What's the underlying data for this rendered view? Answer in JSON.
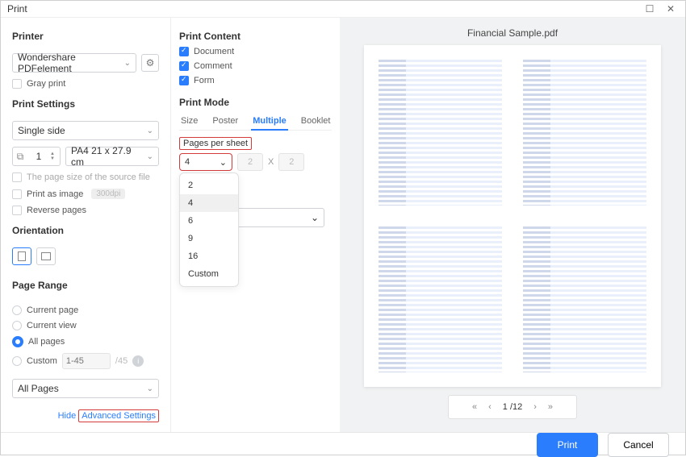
{
  "window": {
    "title": "Print"
  },
  "left": {
    "printer_title": "Printer",
    "printer_selected": "Wondershare PDFelement",
    "gray_print": "Gray print",
    "print_settings_title": "Print Settings",
    "sides_selected": "Single side",
    "copies": "1",
    "page_size_selected": "PA4 21 x 27.9 cm",
    "source_file_note": "The page size of the source file",
    "print_as_image": "Print as image",
    "dpi": "300dpi",
    "reverse_pages": "Reverse pages",
    "orientation_title": "Orientation",
    "page_range_title": "Page Range",
    "range": {
      "current_page": "Current page",
      "current_view": "Current view",
      "all_pages": "All pages",
      "custom": "Custom",
      "custom_placeholder": "1-45",
      "total": "/45"
    },
    "subset_selected": "All Pages",
    "adv": {
      "hide": "Hide",
      "link": "Advanced Settings"
    }
  },
  "mid": {
    "print_content_title": "Print Content",
    "content": {
      "document": "Document",
      "comment": "Comment",
      "form": "Form"
    },
    "print_mode_title": "Print Mode",
    "tabs": {
      "size": "Size",
      "poster": "Poster",
      "multiple": "Multiple",
      "booklet": "Booklet"
    },
    "pps_label": "Pages per sheet",
    "pps_value": "4",
    "x_sym": "X",
    "dim1": "2",
    "dim2": "2",
    "pps_options": [
      "2",
      "4",
      "6",
      "9",
      "16",
      "Custom"
    ],
    "order_value": ""
  },
  "preview": {
    "title": "Financial Sample.pdf",
    "pager": {
      "first": "«",
      "prev": "‹",
      "page": "1 /12",
      "next": "›",
      "last": "»"
    }
  },
  "footer": {
    "print": "Print",
    "cancel": "Cancel"
  }
}
